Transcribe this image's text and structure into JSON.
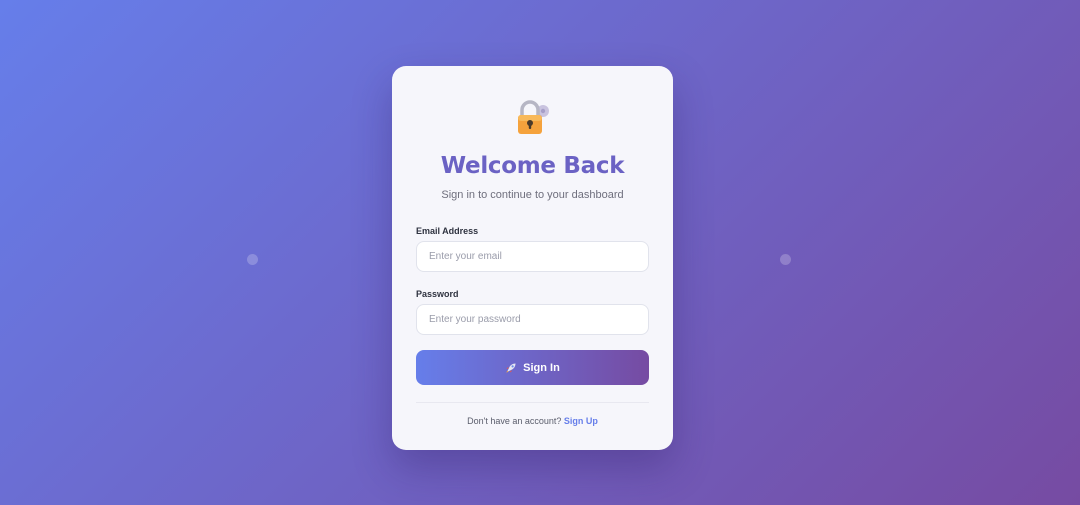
{
  "header": {
    "icon": "lock-with-key-icon",
    "title": "Welcome Back",
    "subtitle": "Sign in to continue to your dashboard"
  },
  "form": {
    "email": {
      "label": "Email Address",
      "placeholder": "Enter your email",
      "value": ""
    },
    "password": {
      "label": "Password",
      "placeholder": "Enter your password",
      "value": ""
    },
    "submit": {
      "icon": "rocket-icon",
      "label": "Sign In"
    }
  },
  "footer": {
    "prompt": "Don't have an account?",
    "link_label": "Sign Up"
  },
  "colors": {
    "gradient_start": "#667eea",
    "gradient_end": "#764ba2",
    "title": "#6b62c4",
    "card": "#f6f6fb"
  }
}
